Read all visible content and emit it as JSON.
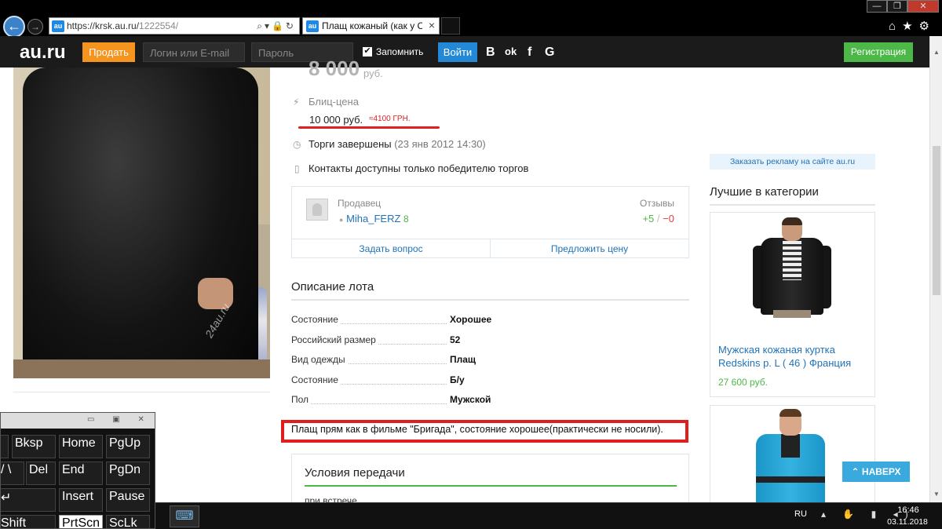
{
  "browser": {
    "url_host": "https://krsk.au.ru/",
    "url_path": "1222554/",
    "tab_title": "Плащ кожаный (как у Са...",
    "tab_close": "×",
    "favicon": "au",
    "back_glyph": "←",
    "forward_glyph": "→",
    "address_icons": "⌕▾🔒↻",
    "tools": "⌂★⚙",
    "window_buttons": {
      "minimize": "—",
      "restore": "❐",
      "close": "✕"
    }
  },
  "header": {
    "logo": "au.ru",
    "sell_button": "Продать",
    "login_placeholder": "Логин или E-mail",
    "password_placeholder": "Пароль",
    "remember_checked": "✔",
    "remember_label": "Запомнить",
    "login_button": "Войти",
    "social": [
      "В",
      "ok",
      "f",
      "G"
    ],
    "register_button": "Регистрация"
  },
  "photo": {
    "watermark": "24au.ru"
  },
  "lot": {
    "current_price": "8 000",
    "current_currency": "руб.",
    "blitz_icon": "⚡",
    "blitz_label": "Блиц-цена",
    "blitz_price": "10 000 руб.",
    "blitz_conversion": "≈4100 ГРН.",
    "clock_icon": "◷",
    "auction_ended": "Торги завершены",
    "auction_ended_date": "(23 янв 2012 14:30)",
    "phone_icon": "▯",
    "contacts_note": "Контакты доступны только победителю торгов"
  },
  "seller": {
    "label": "Продавец",
    "name": "Miha_FERZ",
    "rating": "8",
    "reviews_label": "Отзывы",
    "reviews_positive": "+5",
    "reviews_sep": "/",
    "reviews_negative": "−0",
    "ask_question": "Задать вопрос",
    "offer_price": "Предложить цену"
  },
  "description": {
    "title": "Описание лота",
    "properties": [
      {
        "name": "Состояние",
        "value": "Хорошее"
      },
      {
        "name": "Российский размер",
        "value": "52"
      },
      {
        "name": "Вид одежды",
        "value": "Плащ"
      },
      {
        "name": "Состояние",
        "value": "Б/у"
      },
      {
        "name": "Пол",
        "value": "Мужской"
      }
    ],
    "text": "Плащ прям как в фильме \"Бригада\", состояние хорошее(практически не носили)."
  },
  "conditions": {
    "title": "Условия передачи",
    "text": "при встрече"
  },
  "sidebar": {
    "ad_banner": "Заказать рекламу на сайте au.ru",
    "best_title": "Лучшие в категории",
    "card1_title": "Мужская кожаная куртка Redskins р. L ( 46 ) Франция",
    "card1_price": "27 600 руб.",
    "to_top": "⌃ НАВЕРХ"
  },
  "keyboard": {
    "titlebar_buttons": "▭ ▣ ✕",
    "keys": {
      "bksp": "Bksp",
      "home": "Home",
      "pgup": "PgUp",
      "slash": "/ \\",
      "del": "Del",
      "end": "End",
      "pgdn": "PgDn",
      "enter": "↵",
      "insert": "Insert",
      "pause": "Pause",
      "shift": "Shift",
      "prtscn": "PrtScn",
      "scrlk": "ScLk"
    }
  },
  "taskbar": {
    "app_icon": "⌨",
    "language": "RU",
    "tray_icons": "▴ ✋ ▮ ◂)",
    "time": "16:46",
    "date": "03.11.2018"
  },
  "scroll": {
    "up": "▲",
    "down": "▼"
  }
}
